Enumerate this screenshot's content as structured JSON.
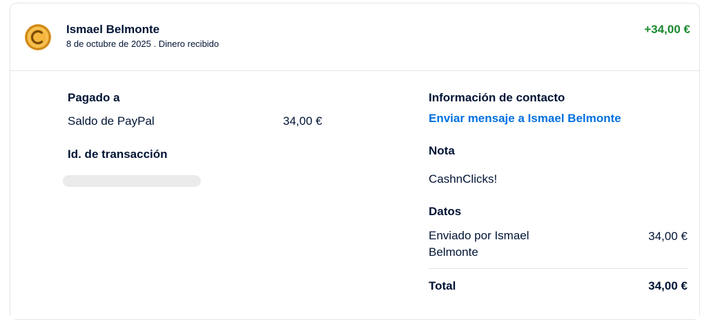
{
  "header": {
    "name": "Ismael Belmonte",
    "subtitle": "8 de octubre de 2025 . Dinero recibido",
    "amount": "+34,00 €",
    "avatar_icon": "coin-icon",
    "amount_color": "#1a8a2f"
  },
  "left": {
    "paid_to_title": "Pagado a",
    "balance_label": "Saldo de PayPal",
    "balance_amount": "34,00 €",
    "transaction_id_title": "Id. de transacción"
  },
  "right": {
    "contact_title": "Información de contacto",
    "contact_link": "Enviar mensaje a Ismael Belmonte",
    "note_title": "Nota",
    "note_text": "CashnClicks!",
    "details_title": "Datos",
    "sent_by_line1": "Enviado por Ismael",
    "sent_by_line2": "Belmonte",
    "sent_by_amount": "34,00 €",
    "total_label": "Total",
    "total_amount": "34,00 €",
    "link_color": "#0070e0"
  }
}
